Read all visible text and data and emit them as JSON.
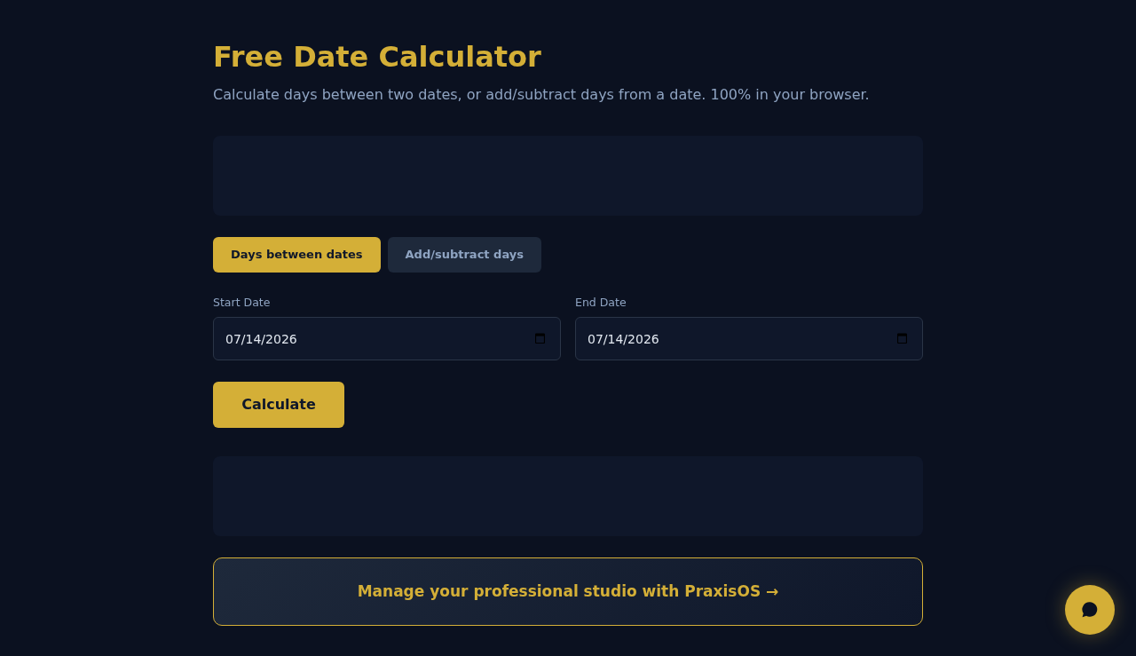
{
  "header": {
    "title": "Free Date Calculator",
    "subtitle": "Calculate days between two dates, or add/subtract days from a date. 100% in your browser."
  },
  "tabs": [
    {
      "label": "Days between dates",
      "selected": true
    },
    {
      "label": "Add/subtract days",
      "selected": false
    }
  ],
  "fields": [
    {
      "label": "Start Date",
      "value": "07/14/2026"
    },
    {
      "label": "End Date",
      "value": "07/14/2026"
    }
  ],
  "calculate_button": {
    "label": "Calculate"
  },
  "promo_banner": {
    "text": "Manage your professional studio with PraxisOS →"
  }
}
